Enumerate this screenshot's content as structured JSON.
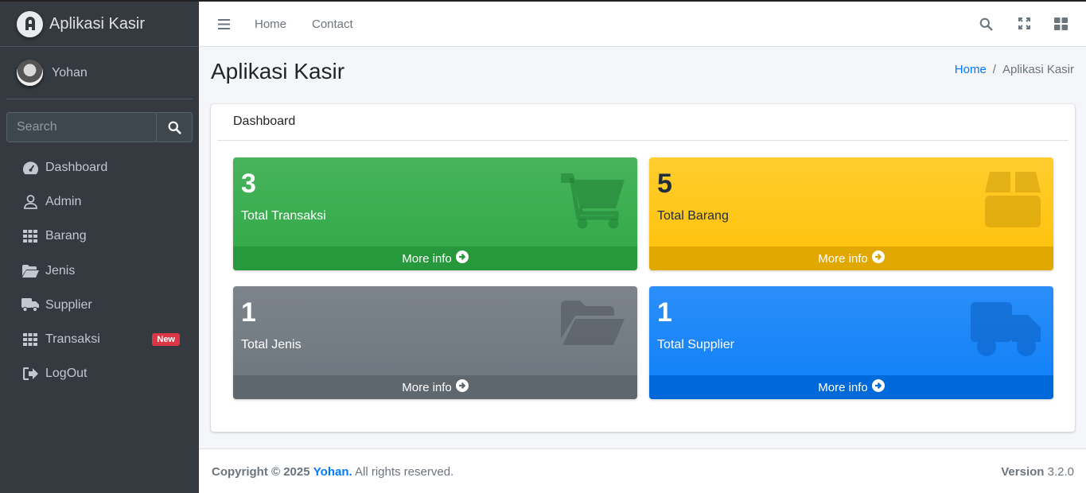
{
  "brand": {
    "title": "Aplikasi Kasir"
  },
  "user": {
    "name": "Yohan"
  },
  "search": {
    "placeholder": "Search"
  },
  "sidebar": {
    "items": [
      {
        "label": "Dashboard",
        "icon": "tachometer-icon"
      },
      {
        "label": "Admin",
        "icon": "user-icon"
      },
      {
        "label": "Barang",
        "icon": "grid-icon"
      },
      {
        "label": "Jenis",
        "icon": "folder-open-icon"
      },
      {
        "label": "Supplier",
        "icon": "truck-icon"
      },
      {
        "label": "Transaksi",
        "icon": "grid-icon",
        "badge": "New"
      },
      {
        "label": "LogOut",
        "icon": "sign-out-icon"
      }
    ]
  },
  "topnav": {
    "home": "Home",
    "contact": "Contact"
  },
  "page": {
    "title": "Aplikasi Kasir"
  },
  "breadcrumb": {
    "home": "Home",
    "separator": "/",
    "current": "Aplikasi Kasir"
  },
  "card": {
    "title": "Dashboard"
  },
  "boxes": [
    {
      "value": "3",
      "label": "Total Transaksi",
      "more": "More info",
      "color": "#28a745",
      "icon": "shopping-cart-icon"
    },
    {
      "value": "5",
      "label": "Total Barang",
      "more": "More info",
      "color": "#ffc107",
      "icon": "box-icon"
    },
    {
      "value": "1",
      "label": "Total Jenis",
      "more": "More info",
      "color": "#6c757d",
      "icon": "folder-open-icon"
    },
    {
      "value": "1",
      "label": "Total Supplier",
      "more": "More info",
      "color": "#007bff",
      "icon": "truck-icon"
    }
  ],
  "footer": {
    "copyright_prefix": "Copyright © 2025",
    "owner": "Yohan.",
    "rights": "All rights reserved.",
    "version_label": "Version",
    "version": "3.2.0"
  }
}
